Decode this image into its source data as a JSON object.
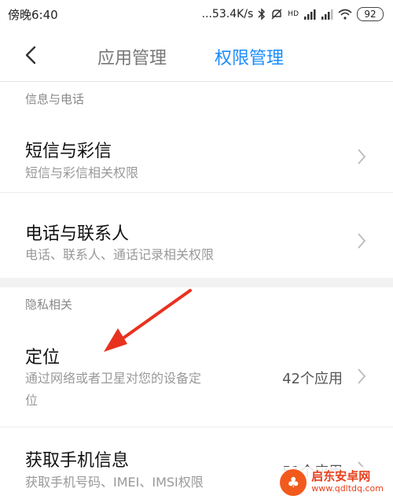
{
  "status_bar": {
    "time": "傍晚6:40",
    "network_speed": "...53.4K/s",
    "hd_label": "HD",
    "battery": "92",
    "icons": [
      "bluetooth-icon",
      "mute-icon",
      "signal-icon",
      "wifi-icon",
      "battery-icon"
    ]
  },
  "header": {
    "back_icon": "chevron-left-icon",
    "tabs": [
      {
        "label": "应用管理",
        "active": false
      },
      {
        "label": "权限管理",
        "active": true
      }
    ],
    "active_color": "#1a8cff"
  },
  "sections": [
    {
      "header": "信息与电话",
      "items": [
        {
          "title": "短信与彩信",
          "subtitle": "短信与彩信相关权限",
          "count": ""
        },
        {
          "title": "电话与联系人",
          "subtitle": "电话、联系人、通话记录相关权限",
          "count": ""
        }
      ]
    },
    {
      "header": "隐私相关",
      "items": [
        {
          "title": "定位",
          "subtitle_line1": "通过网络或者卫星对您的设备定",
          "subtitle_line2": "位",
          "count": "42个应用"
        },
        {
          "title": "获取手机信息",
          "subtitle": "获取手机号码、IMEI、IMSI权限",
          "count": "51个应用"
        }
      ]
    }
  ],
  "annotation": {
    "arrow_color": "#e8321e"
  },
  "watermark": {
    "name": "启东安卓网",
    "url": "www.qdltdq.com"
  }
}
